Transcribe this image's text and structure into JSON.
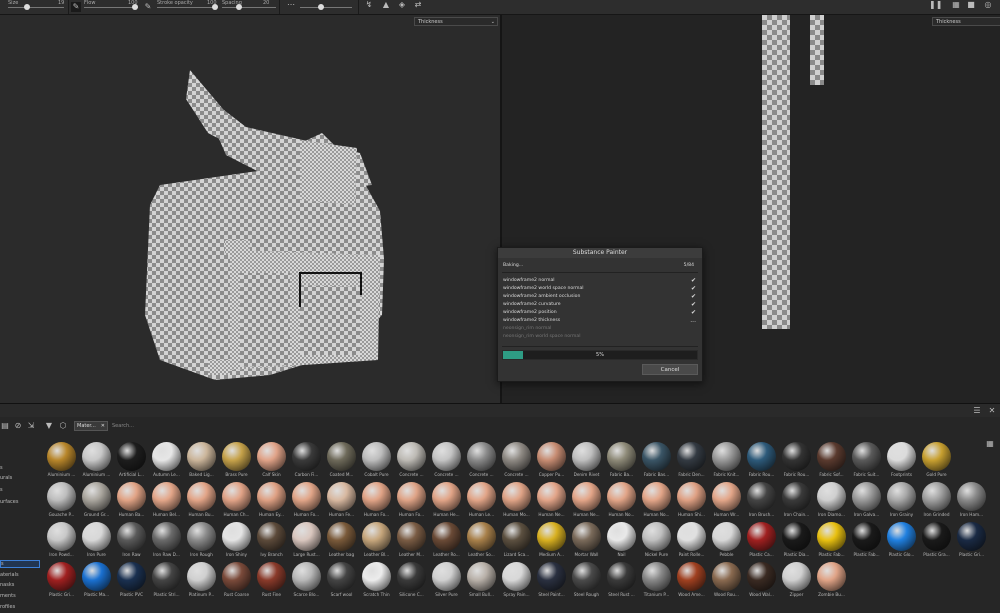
{
  "toolbar": {
    "size_label": "Size",
    "size_value": "19",
    "flow_label": "Flow",
    "flow_value": "100",
    "stroke_opacity_label": "Stroke opacity",
    "stroke_opacity_value": "100",
    "spacing_label": "Spacing",
    "spacing_value": "20"
  },
  "viewport3d": {
    "channel": "Thickness"
  },
  "viewport2d": {
    "channel": "Thickness"
  },
  "dialog": {
    "title": "Substance Painter",
    "status": "Baking...",
    "count": "5/84",
    "items": [
      {
        "label": "windowframe2 normal",
        "done": true
      },
      {
        "label": "windowframe2 world space normal",
        "done": true
      },
      {
        "label": "windowframe2 ambient occlusion",
        "done": true
      },
      {
        "label": "windowframe2 curvature",
        "done": true
      },
      {
        "label": "windowframe2 position",
        "done": true
      },
      {
        "label": "windowframe2 thickness",
        "done": false,
        "mark": "..."
      },
      {
        "label": "neonsign_rim normal",
        "done": false,
        "muted": true
      },
      {
        "label": "neonsign_rim world space normal",
        "done": false,
        "muted": true
      }
    ],
    "progress_text": "5%",
    "progress": 0.05,
    "cancel_label": "Cancel"
  },
  "shelf": {
    "tab_label": "Mater...",
    "search_placeholder": "Search...",
    "categories": [
      "s",
      "urals",
      "s",
      "urfaces",
      "",
      "",
      "",
      "s",
      "aterials",
      "nasks",
      "ments",
      "rofiles"
    ],
    "selected_category": "s",
    "materials": [
      [
        "Aluminium ...",
        "Aluminium ...",
        "Artificial L...",
        "Autumn Le...",
        "Baked Lig...",
        "Brass Pure",
        "Calf Skin",
        "Carbon Fi...",
        "Coated M...",
        "Cobalt Pure",
        "Concrete ...",
        "Concrete ...",
        "Concrete ...",
        "Concrete ...",
        "Copper Pu...",
        "Denim Rivet",
        "Fabric Ba...",
        "Fabric Bas...",
        "Fabric Den...",
        "Fabric Knit...",
        "Fabric Rou...",
        "Fabric Rou...",
        "Fabric Sof...",
        "Fabric Suit...",
        "Footprints",
        "Gold Pure"
      ],
      [
        "Gouache P...",
        "Ground Gr...",
        "Human Ba...",
        "Human Bel...",
        "Human Bu...",
        "Human Ch...",
        "Human Ey...",
        "Human Fo...",
        "Human Fe...",
        "Human Fo...",
        "Human Fo...",
        "Human He...",
        "Human Le...",
        "Human Mo...",
        "Human Ne...",
        "Human Ne...",
        "Human No...",
        "Human No...",
        "Human Shi...",
        "Human Wr...",
        "Iron Brush...",
        "Iron Chain...",
        "Iron Diamo...",
        "Iron Galva...",
        "Iron Grainy",
        "Iron Grinded",
        "Iron Ham..."
      ],
      [
        "Iron Powd...",
        "Iron Pure",
        "Iron Raw",
        "Iron Raw D...",
        "Iron Rough",
        "Iron Shiny",
        "Ivy Branch",
        "Large Rust...",
        "Leather bag",
        "Leather Bl...",
        "Leather M...",
        "Leather Ro...",
        "Leather So...",
        "Lizard Sca...",
        "Medium A...",
        "Mortar Wall",
        "Nail",
        "Nickel Pure",
        "Paint Rolle...",
        "Pebble",
        "Plastic Ca...",
        "Plastic Dia...",
        "Plastic Fab...",
        "Plastic Fab...",
        "Plastic Glo...",
        "Plastic Gra...",
        "Plastic Gri..."
      ],
      [
        "Plastic Gri...",
        "Plastic Ma...",
        "Plastic PVC",
        "Plastic Stri...",
        "Platinum P...",
        "Rust Coarse",
        "Rust Fine",
        "Scarce Blo...",
        "Scarf wool",
        "Scratch Thin",
        "Silicone C...",
        "Silver Pure",
        "Small Bull...",
        "Spray Pain...",
        "Steel Paint...",
        "Steel Rough",
        "Steel Rust ...",
        "Titanium P...",
        "Wood Ame...",
        "Wood Rou...",
        "Wood Wal...",
        "Zipper",
        "Zombie Bu..."
      ]
    ],
    "colors": [
      [
        "#b8862a",
        "#c8c8c8",
        "#1d1d1d",
        "#e6e6e6",
        "#cbb59a",
        "#c6a24a",
        "#e0a287",
        "#3a3a3a",
        "#6e6a5a",
        "#bdbdbd",
        "#bdbab4",
        "#c4c4c4",
        "#8a8a8a",
        "#8f8a84",
        "#c78c72",
        "#bfbfbf",
        "#8e8a78",
        "#3a5566",
        "#333a42",
        "#9a9a9a",
        "#2d5a7a",
        "#333",
        "#5a3a2e",
        "#5a5a5a",
        "#dcdcdc",
        "#c8a030"
      ],
      [
        "#bdbdbd",
        "#aaa69e",
        "#e1a385",
        "#e3a689",
        "#e2a487",
        "#e1a387",
        "#dea083",
        "#e1a588",
        "#d8b8a0",
        "#e0a386",
        "#dfa386",
        "#e1a487",
        "#e1a487",
        "#dfa386",
        "#e2a488",
        "#e3a588",
        "#e1a487",
        "#e2a588",
        "#dfa083",
        "#e3a689",
        "#444",
        "#3a3a3a",
        "#cfcfcf",
        "#9a9a9a",
        "#a8a8a8",
        "#a0a0a0",
        "#8a8a8a"
      ],
      [
        "#c8c8c8",
        "#d8d8d8",
        "#5a5a5a",
        "#6a6a6a",
        "#8a8a8a",
        "#e4e4e4",
        "#5c4a3a",
        "#d9c6be",
        "#7a5a3a",
        "#c6a67c",
        "#7a5c44",
        "#6a4a36",
        "#a8804a",
        "#5c5040",
        "#d8b020",
        "#7a6a5a",
        "#e8e8e8",
        "#bfbfbf",
        "#e0e0e0",
        "#d8d8d8",
        "#a02020",
        "#1a1a1a",
        "#e8c010",
        "#1a1a1a",
        "#2080e0",
        "#1a1a1a",
        "#1a2a44"
      ],
      [
        "#a02020",
        "#1a70d0",
        "#1a3050",
        "#444",
        "#cfcfcf",
        "#7a4a3a",
        "#8a3a2a",
        "#b8b8b8",
        "#444",
        "#ececec",
        "#3a3a3a",
        "#d0d0d0",
        "#b8b0a8",
        "#d8d8d8",
        "#2a3040",
        "#4a4a4a",
        "#3a3a3a",
        "#888",
        "#a04020",
        "#8a6a50",
        "#3a2a22",
        "#d0d0d0",
        "#e0a386"
      ]
    ]
  }
}
